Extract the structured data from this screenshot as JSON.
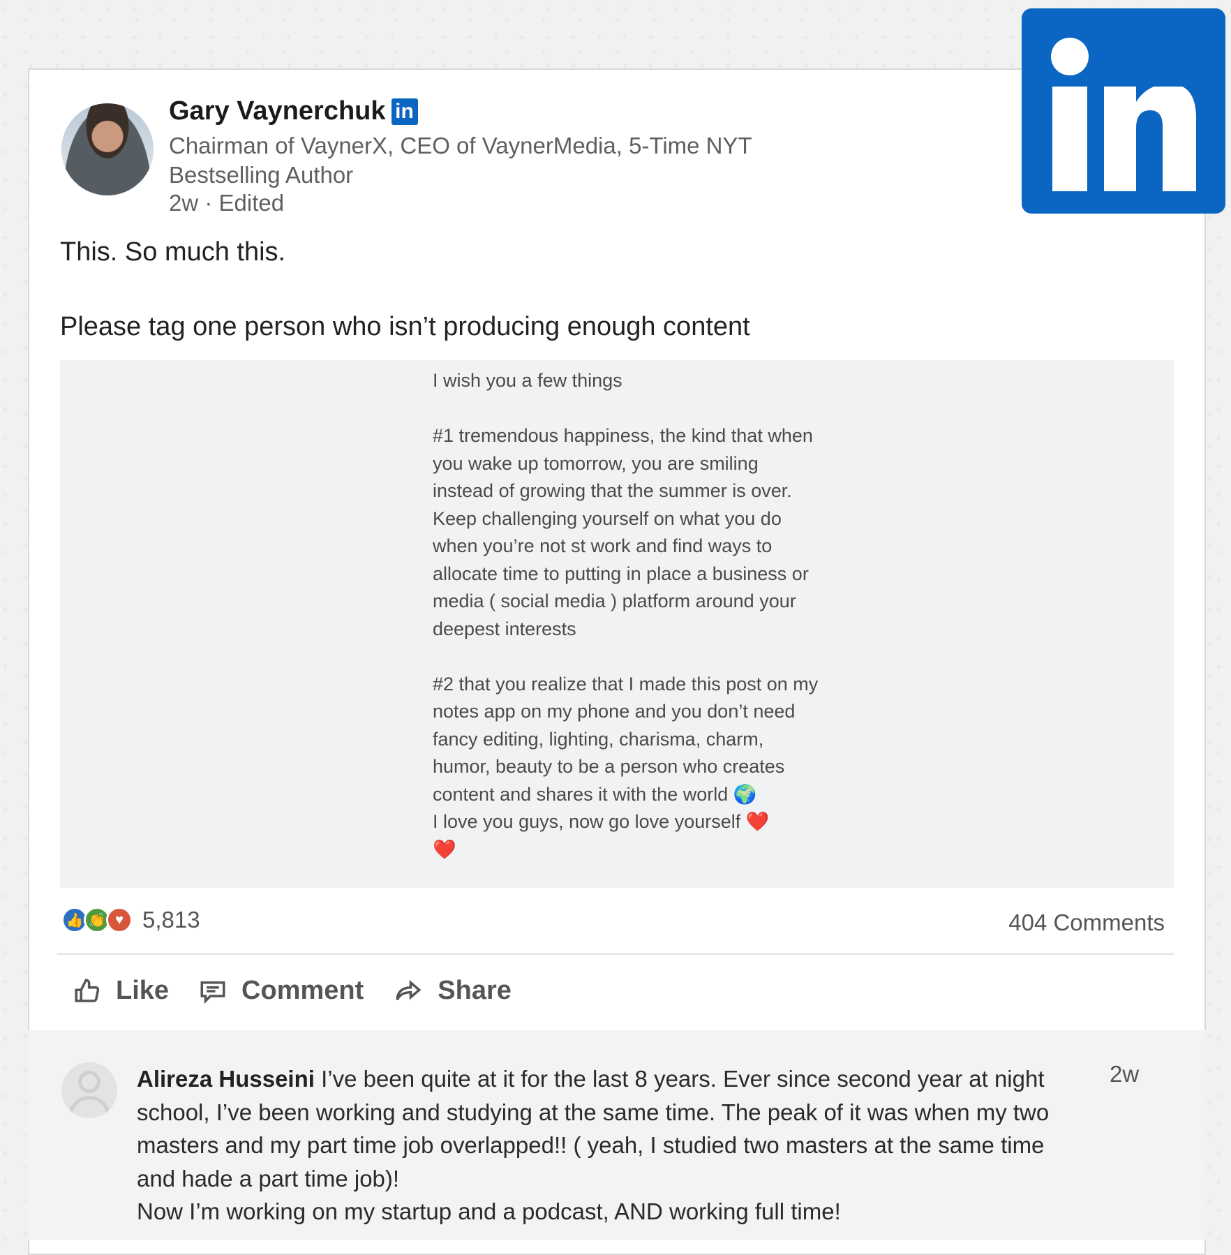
{
  "post": {
    "author": "Gary Vaynerchuk",
    "author_badge": "in",
    "headline": "Chairman of VaynerX, CEO of VaynerMedia, 5-Time NYT Bestselling Author",
    "meta": "2w · Edited",
    "text_line1": "This. So much this.",
    "text_line2": "Please tag one person who isn’t producing enough content",
    "image_note": {
      "p1": "I wish you a few things",
      "p2": "#1 tremendous happiness, the kind that when you wake up tomorrow, you are smiling instead of growing that the summer is over. Keep challenging yourself on what you do when you’re not st work and find ways to allocate time to putting in place a business or media ( social media ) platform around your deepest interests",
      "p3": "#2 that you realize that I made this post on my notes app on my phone and you don’t need fancy editing, lighting, charisma, charm, humor, beauty to be a person who creates content and shares it with the world",
      "globe": "🌍",
      "p4": "I love you guys, now go love yourself",
      "heart": "❤️"
    }
  },
  "social": {
    "reaction_count": "5,813",
    "comments_count": "404 Comments",
    "reaction_icons": [
      "like-icon",
      "celebrate-icon",
      "love-icon"
    ]
  },
  "actions": {
    "like": "Like",
    "comment": "Comment",
    "share": "Share"
  },
  "comment": {
    "author": "Alireza Husseini",
    "text": "I’ve been quite at it for the last 8 years. Ever since second year at night school, I’ve been working and studying at the same time. The peak of it was when my two masters and my part time job overlapped!! ( yeah, I studied two masters at the same time and hade a part time job)!",
    "text2": "Now I’m working on my startup and a podcast, AND working full time!",
    "time": "2w"
  },
  "colors": {
    "linkedin_blue": "#0a66c2",
    "like": "#2b6fc0",
    "celebrate": "#4b9a3c",
    "love": "#d7573b"
  }
}
